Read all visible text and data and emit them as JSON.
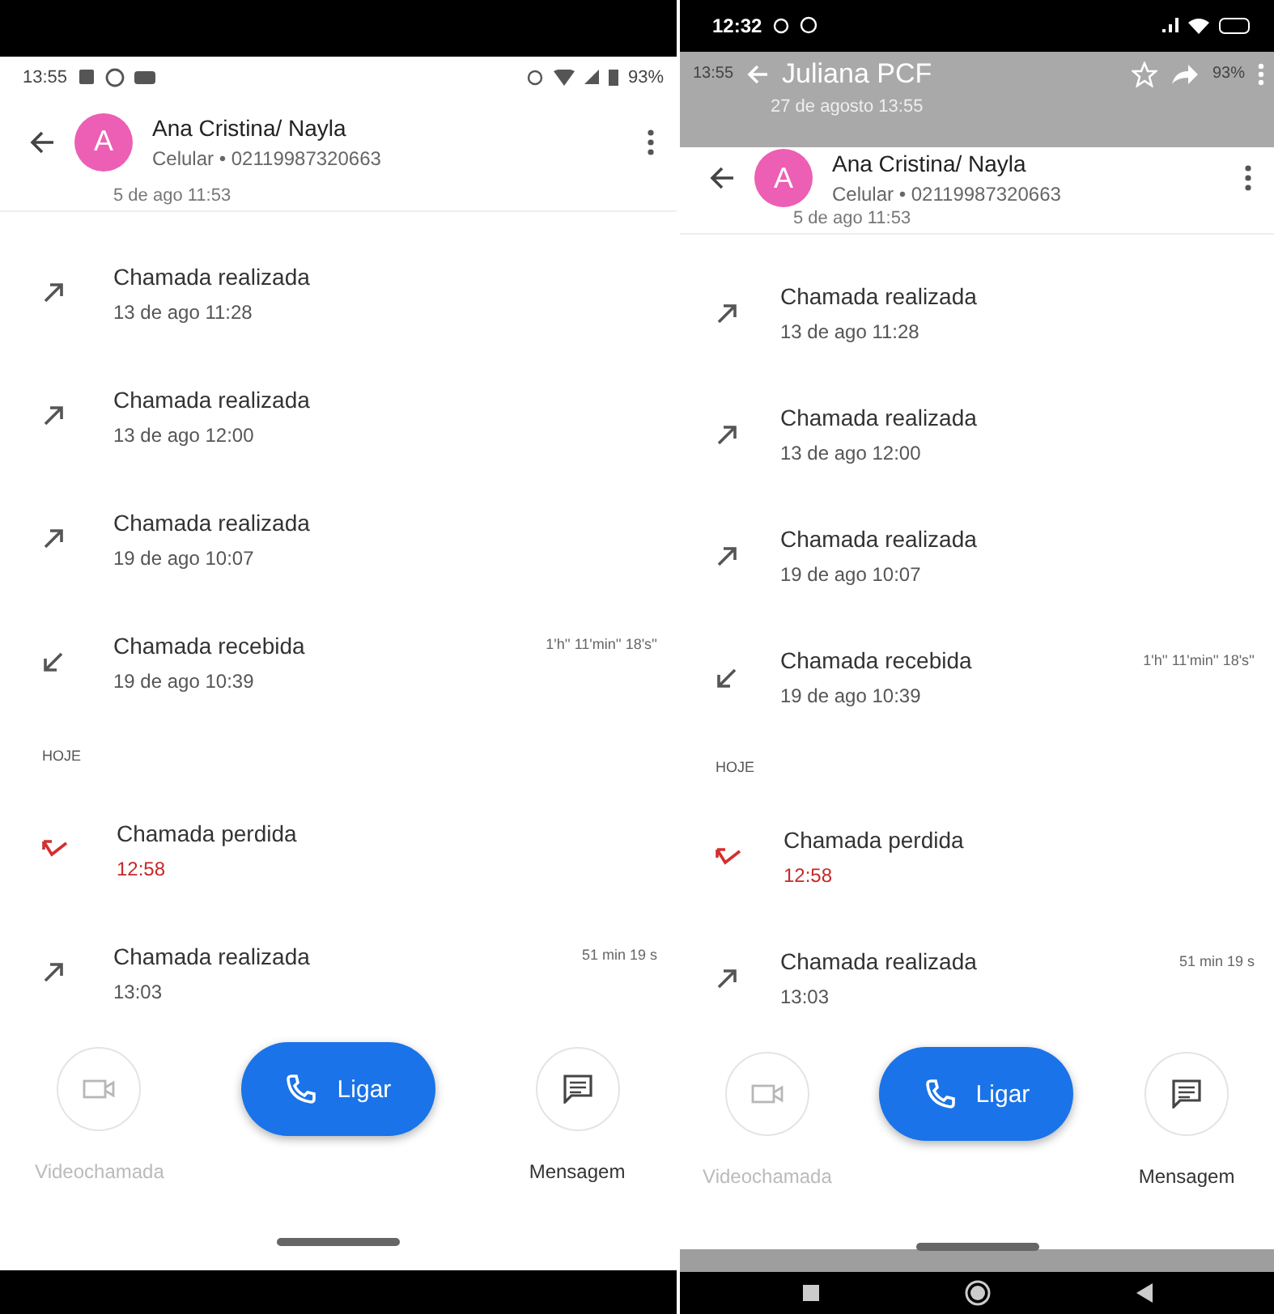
{
  "left_screen": {
    "status_bar": {
      "time": "13:55",
      "battery": "93%"
    },
    "contact": {
      "initial": "A",
      "name": "Ana Cristina/ Nayla",
      "subtitle": "Celular • 02119987320663"
    },
    "cut_row_text": "5 de ago 11:53",
    "items": [
      {
        "kind": "outgoing",
        "title": "Chamada realizada",
        "time": "13 de ago 11:28"
      },
      {
        "kind": "outgoing",
        "title": "Chamada realizada",
        "time": "13 de ago 12:00"
      },
      {
        "kind": "outgoing",
        "title": "Chamada realizada",
        "time": "19 de ago 10:07"
      },
      {
        "kind": "incoming",
        "title": "Chamada recebida",
        "time": "19 de ago 10:39",
        "duration": "1'h'' 11'min'' 18's''"
      },
      {
        "kind": "section",
        "title": "HOJE"
      },
      {
        "kind": "missed",
        "title": "Chamada perdida",
        "time": "12:58"
      },
      {
        "kind": "outgoing",
        "title": "Chamada realizada",
        "time": "13:03",
        "duration": "51 min 19 s"
      }
    ],
    "actions": [
      {
        "kind": "video",
        "label": "Videochamada",
        "disabled": true
      },
      {
        "kind": "call",
        "label": "Ligar",
        "disabled": false
      },
      {
        "kind": "message",
        "label": "Mensagem",
        "disabled": false
      }
    ]
  },
  "right_screen": {
    "phone_status": {
      "time": "12:32"
    },
    "viewer": {
      "title": "Juliana PCF",
      "date": "27 de agosto 13:55"
    },
    "status_bar": {
      "time": "13:55",
      "battery": "93%"
    },
    "contact": {
      "initial": "A",
      "name": "Ana Cristina/ Nayla",
      "subtitle": "Celular • 02119987320663"
    },
    "cut_row_text": "5 de ago 11:53",
    "items": [
      {
        "kind": "outgoing",
        "title": "Chamada realizada",
        "time": "13 de ago 11:28"
      },
      {
        "kind": "outgoing",
        "title": "Chamada realizada",
        "time": "13 de ago 12:00"
      },
      {
        "kind": "outgoing",
        "title": "Chamada realizada",
        "time": "19 de ago 10:07"
      },
      {
        "kind": "incoming",
        "title": "Chamada recebida",
        "time": "19 de ago 10:39",
        "duration": "1'h'' 11'min'' 18's''"
      },
      {
        "kind": "section",
        "title": "HOJE"
      },
      {
        "kind": "missed",
        "title": "Chamada perdida",
        "time": "12:58"
      },
      {
        "kind": "outgoing",
        "title": "Chamada realizada",
        "time": "13:03",
        "duration": "51 min 19 s"
      }
    ],
    "actions": [
      {
        "kind": "video",
        "label": "Videochamada",
        "disabled": true
      },
      {
        "kind": "call",
        "label": "Ligar",
        "disabled": false
      },
      {
        "kind": "message",
        "label": "Mensagem",
        "disabled": false
      }
    ]
  }
}
